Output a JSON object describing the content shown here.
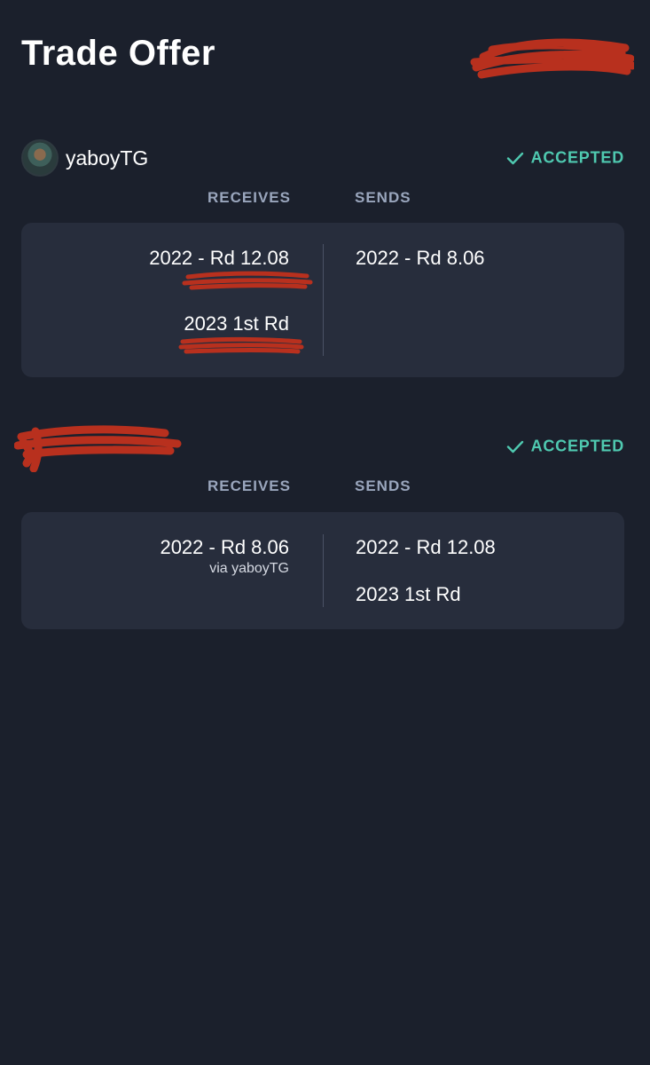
{
  "header": {
    "title": "Trade Offer"
  },
  "columns": {
    "receives_label": "RECEIVES",
    "sends_label": "SENDS"
  },
  "parties": [
    {
      "name": "yaboyTG",
      "status": "ACCEPTED",
      "receives": [
        {
          "pick": "2022 - Rd 12.08"
        },
        {
          "pick": "2023 1st Rd"
        }
      ],
      "sends": [
        {
          "pick": "2022 - Rd 8.06"
        }
      ]
    },
    {
      "name": "",
      "status": "ACCEPTED",
      "receives": [
        {
          "pick": "2022 - Rd 8.06",
          "via": "via yaboyTG"
        }
      ],
      "sends": [
        {
          "pick": "2022 - Rd 12.08"
        },
        {
          "pick": "2023 1st Rd"
        }
      ]
    }
  ],
  "colors": {
    "background": "#1b202c",
    "card": "#272d3c",
    "accent_accepted": "#4fc9b0",
    "column_label": "#9aa6bd",
    "redaction": "#b8301e"
  },
  "icons": {
    "status": "checkmark-icon"
  }
}
